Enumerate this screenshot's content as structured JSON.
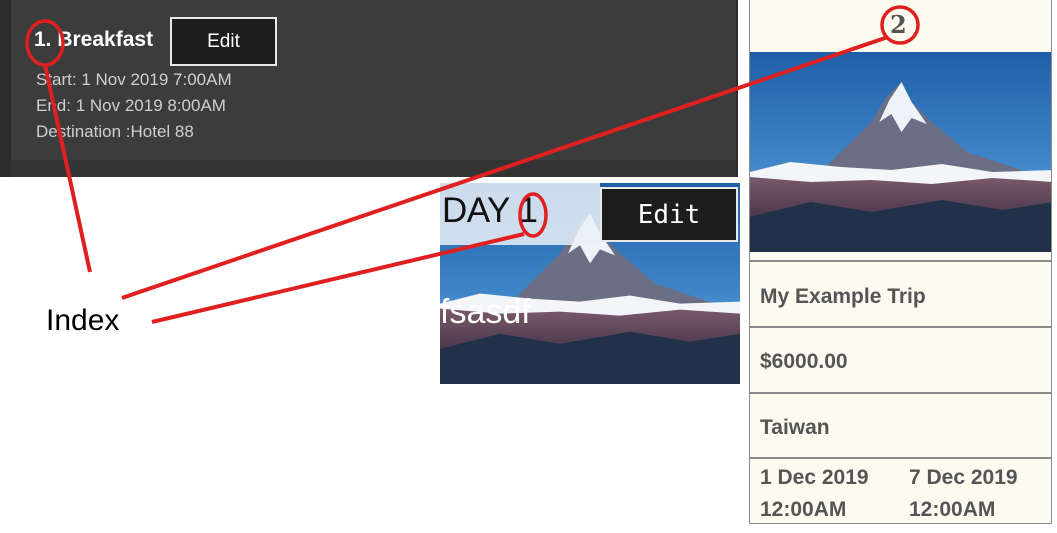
{
  "event_card": {
    "title": "1. Breakfast",
    "edit_label": "Edit",
    "start": "Start: 1 Nov 2019 7:00AM",
    "end": "End: 1 Nov 2019 8:00AM",
    "destination": "Destination :Hotel 88"
  },
  "day_card": {
    "day_label": "DAY 1",
    "edit_label": "Edit",
    "name": "fsasdf"
  },
  "trip_card": {
    "index": "2",
    "name": "My Example Trip",
    "budget": "$6000.00",
    "destination": "Taiwan",
    "start_date": "1 Dec 2019",
    "start_time": "12:00AM",
    "end_date": "7 Dec 2019",
    "end_time": "12:00AM"
  },
  "annotation": {
    "label": "Index",
    "color": "#e02020"
  },
  "colors": {
    "dark_card": "#3c3c3c",
    "trip_card_bg": "#fdfbf0",
    "trip_text": "#555555"
  },
  "icons": {
    "mountain_image": "mountain-landscape-image"
  }
}
